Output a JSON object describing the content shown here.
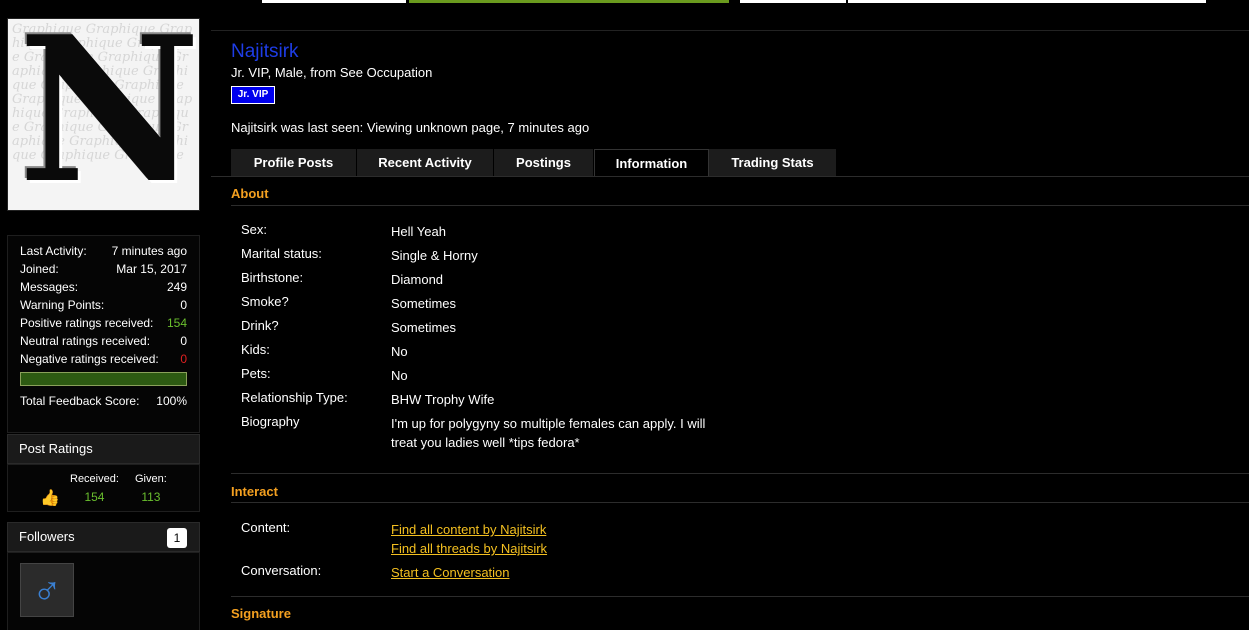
{
  "profile": {
    "username": "Najitsirk",
    "user_title": "Jr. VIP, Male, from See Occupation",
    "rank_badge": "Jr. VIP",
    "last_seen": "Najitsirk was last seen: Viewing unknown page, 7 minutes ago",
    "avatar_letter": "N",
    "avatar_watermark": "Graphique"
  },
  "stats": [
    {
      "label": "Last Activity:",
      "value": "7 minutes ago"
    },
    {
      "label": "Joined:",
      "value": "Mar 15, 2017"
    },
    {
      "label": "Messages:",
      "value": "249"
    },
    {
      "label": "Warning Points:",
      "value": "0"
    },
    {
      "label": "Positive ratings received:",
      "value": "154"
    },
    {
      "label": "Neutral ratings received:",
      "value": "0"
    },
    {
      "label": "Negative ratings received:",
      "value": "0"
    }
  ],
  "feedback": {
    "label": "Total Feedback Score:",
    "value": "100%",
    "fraction": 1.0
  },
  "post_ratings": {
    "title": "Post Ratings",
    "received_label": "Received:",
    "received": "154",
    "given_label": "Given:",
    "given": "113"
  },
  "followers": {
    "title": "Followers",
    "count": "1",
    "follower_icon": "male-symbol-icon"
  },
  "tabs": [
    "Profile Posts",
    "Recent Activity",
    "Postings",
    "Information",
    "Trading Stats"
  ],
  "active_tab": "Information",
  "about": {
    "title": "About",
    "rows": [
      {
        "label": "Sex:",
        "value": "Hell Yeah"
      },
      {
        "label": "Marital status:",
        "value": "Single & Horny"
      },
      {
        "label": "Birthstone:",
        "value": "Diamond"
      },
      {
        "label": "Smoke?",
        "value": "Sometimes"
      },
      {
        "label": "Drink?",
        "value": "Sometimes"
      },
      {
        "label": "Kids:",
        "value": "No"
      },
      {
        "label": "Pets:",
        "value": "No"
      },
      {
        "label": "Relationship Type:",
        "value": "BHW Trophy Wife"
      },
      {
        "label": "Biography",
        "value": "I'm up for polygyny so multiple females can apply. I will treat you ladies well *tips fedora*"
      }
    ]
  },
  "interact": {
    "title": "Interact",
    "content_label": "Content:",
    "content_links": [
      "Find all content by Najitsirk",
      "Find all threads by Najitsirk"
    ],
    "conversation_label": "Conversation:",
    "conversation_link": "Start a Conversation"
  },
  "signature": {
    "title": "Signature"
  },
  "colors": {
    "accent": "#f4a020",
    "link": "#f4c020",
    "username": "#1e3de6",
    "positive": "#6abf2e",
    "negative": "#e02020",
    "badge": "#0000ee"
  }
}
